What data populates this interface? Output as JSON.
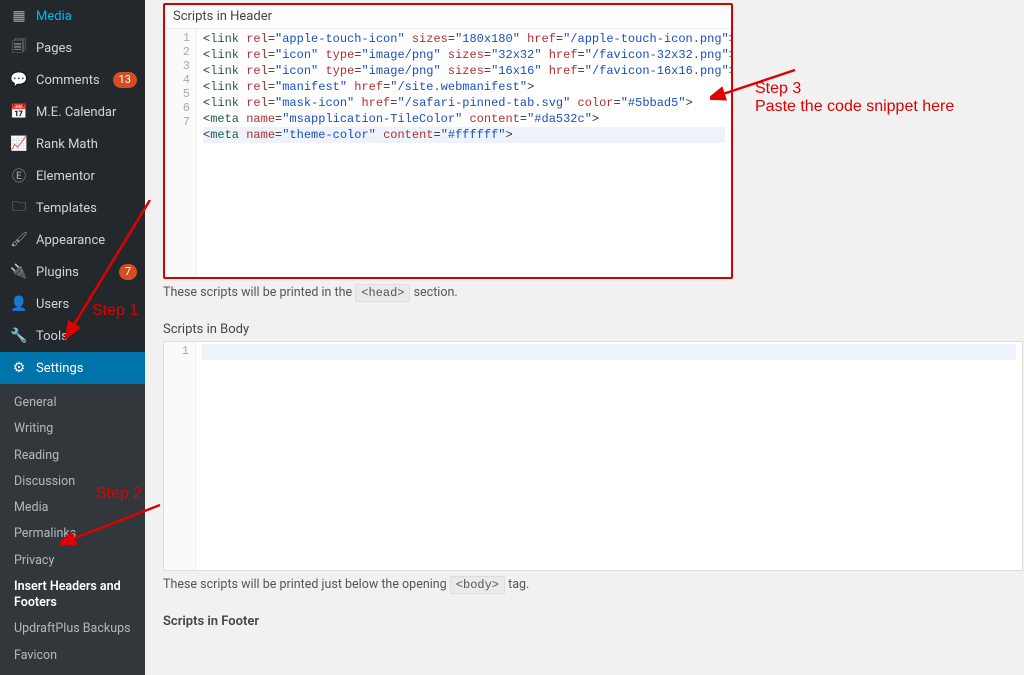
{
  "sidebar": {
    "items": [
      {
        "icon": "▦",
        "label": "Media",
        "truncated": true
      },
      {
        "icon": "🗐",
        "label": "Pages"
      },
      {
        "icon": "💬",
        "label": "Comments",
        "badge": "13"
      },
      {
        "icon": "📅",
        "label": "M.E. Calendar"
      },
      {
        "icon": "📈",
        "label": "Rank Math"
      },
      {
        "icon": "Ⓔ",
        "label": "Elementor"
      },
      {
        "icon": "🗀",
        "label": "Templates"
      },
      {
        "icon": "🖌",
        "label": "Appearance"
      },
      {
        "icon": "🔌",
        "label": "Plugins",
        "badge": "7"
      },
      {
        "icon": "👤",
        "label": "Users"
      },
      {
        "icon": "🔧",
        "label": "Tools"
      },
      {
        "icon": "⚙",
        "label": "Settings",
        "active": true
      }
    ],
    "submenu": [
      {
        "label": "General"
      },
      {
        "label": "Writing"
      },
      {
        "label": "Reading"
      },
      {
        "label": "Discussion"
      },
      {
        "label": "Media"
      },
      {
        "label": "Permalinks"
      },
      {
        "label": "Privacy"
      },
      {
        "label": "Insert Headers and Footers",
        "current": true
      },
      {
        "label": "UpdraftPlus Backups"
      },
      {
        "label": "Favicon"
      }
    ]
  },
  "annotations": {
    "step1": "Step 1",
    "step2": "Step 2",
    "step3_a": "Step 3",
    "step3_b": "Paste the code snippet here"
  },
  "header_section": {
    "title": "Scripts in Header",
    "line_numbers": [
      "1",
      "2",
      "3",
      "4",
      "5",
      "6",
      "7"
    ],
    "lines": [
      {
        "tag": "link",
        "attrs": [
          [
            "rel",
            "apple-touch-icon"
          ],
          [
            "sizes",
            "180x180"
          ],
          [
            "href",
            "/apple-touch-icon.png"
          ]
        ]
      },
      {
        "tag": "link",
        "attrs": [
          [
            "rel",
            "icon"
          ],
          [
            "type",
            "image/png"
          ],
          [
            "sizes",
            "32x32"
          ],
          [
            "href",
            "/favicon-32x32.png"
          ]
        ]
      },
      {
        "tag": "link",
        "attrs": [
          [
            "rel",
            "icon"
          ],
          [
            "type",
            "image/png"
          ],
          [
            "sizes",
            "16x16"
          ],
          [
            "href",
            "/favicon-16x16.png"
          ]
        ]
      },
      {
        "tag": "link",
        "attrs": [
          [
            "rel",
            "manifest"
          ],
          [
            "href",
            "/site.webmanifest"
          ]
        ]
      },
      {
        "tag": "link",
        "attrs": [
          [
            "rel",
            "mask-icon"
          ],
          [
            "href",
            "/safari-pinned-tab.svg"
          ],
          [
            "color",
            "#5bbad5"
          ]
        ]
      },
      {
        "tag": "meta",
        "attrs": [
          [
            "name",
            "msapplication-TileColor"
          ],
          [
            "content",
            "#da532c"
          ]
        ]
      },
      {
        "tag": "meta",
        "attrs": [
          [
            "name",
            "theme-color"
          ],
          [
            "content",
            "#ffffff"
          ]
        ]
      }
    ],
    "hint_pre": "These scripts will be printed in the ",
    "hint_code": "<head>",
    "hint_post": " section."
  },
  "body_section": {
    "title": "Scripts in Body",
    "line_numbers": [
      "1"
    ],
    "hint_pre": "These scripts will be printed just below the opening ",
    "hint_code": "<body>",
    "hint_post": " tag."
  },
  "footer_section": {
    "title": "Scripts in Footer"
  }
}
